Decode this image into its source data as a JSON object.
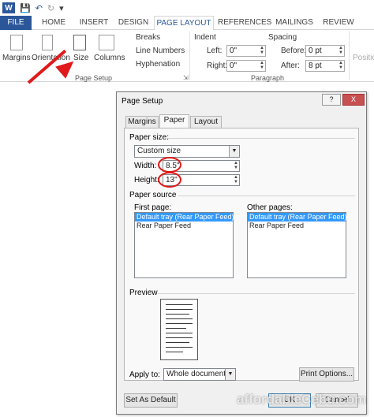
{
  "qat": {
    "app_logo": "W",
    "save_icon": "floppy-icon",
    "undo_icon": "undo-icon",
    "redo_icon": "redo-icon",
    "customize_icon": "qat-more-icon"
  },
  "tabs": [
    "FILE",
    "HOME",
    "INSERT",
    "DESIGN",
    "PAGE LAYOUT",
    "REFERENCES",
    "MAILINGS",
    "REVIEW"
  ],
  "active_tab": "PAGE LAYOUT",
  "ribbon": {
    "page_setup": {
      "margins": "Margins",
      "orientation": "Orientation",
      "size": "Size",
      "columns": "Columns",
      "breaks": "Breaks",
      "line_numbers": "Line Numbers",
      "hyphenation": "Hyphenation",
      "group": "Page Setup"
    },
    "indent": {
      "title": "Indent",
      "left_label": "Left:",
      "left_value": "0\"",
      "right_label": "Right:",
      "right_value": "0\""
    },
    "spacing": {
      "title": "Spacing",
      "before_label": "Before:",
      "before_value": "0 pt",
      "after_label": "After:",
      "after_value": "8 pt"
    },
    "paragraph_group": "Paragraph",
    "partial_label": "Positio"
  },
  "dialog": {
    "title": "Page Setup",
    "help": "?",
    "close": "X",
    "tabs": [
      "Margins",
      "Paper",
      "Layout"
    ],
    "active_tab": "Paper",
    "paper_size_label": "Paper size:",
    "paper_size_value": "Custom size",
    "width_label": "Width:",
    "width_value": "8.5\"",
    "height_label": "Height:",
    "height_value": "13\"",
    "paper_source_label": "Paper source",
    "first_page_label": "First page:",
    "other_pages_label": "Other pages:",
    "first_page_options": [
      "Default tray (Rear Paper Feed)",
      "Rear Paper Feed"
    ],
    "other_pages_options": [
      "Default tray (Rear Paper Feed)",
      "Rear Paper Feed"
    ],
    "preview_label": "Preview",
    "apply_to_label": "Apply to:",
    "apply_to_value": "Whole document",
    "print_options": "Print Options...",
    "set_default": "Set As Default",
    "ok": "OK",
    "cancel": "Cancel"
  },
  "watermark": "affordableCebu.com",
  "colors": {
    "accent": "#2b579a",
    "highlight_oval": "#e01a1a",
    "selection": "#3399ff"
  }
}
